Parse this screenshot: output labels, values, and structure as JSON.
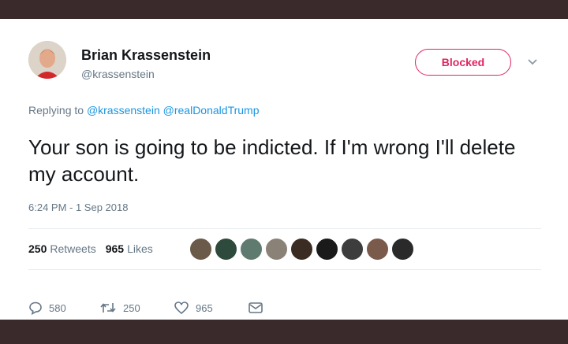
{
  "tweet": {
    "author_name": "Brian Krassenstein",
    "author_handle": "@krassenstein",
    "blocked_label": "Blocked",
    "replying_prefix": "Replying to",
    "reply_mentions": [
      "@krassenstein",
      "@realDonaldTrump"
    ],
    "text": "Your son is going to be indicted. If I'm wrong I'll delete my account.",
    "timestamp": "6:24 PM - 1 Sep 2018"
  },
  "stats": {
    "retweets_count": "250",
    "retweets_label": "Retweets",
    "likes_count": "965",
    "likes_label": "Likes"
  },
  "likers": [
    {
      "icon": "liker-avatar",
      "color": "#6b5a4a"
    },
    {
      "icon": "liker-avatar",
      "color": "#2e4a3c"
    },
    {
      "icon": "liker-avatar",
      "color": "#5f7a6e"
    },
    {
      "icon": "liker-avatar",
      "color": "#8a8276"
    },
    {
      "icon": "liker-avatar",
      "color": "#3a2c22"
    },
    {
      "icon": "liker-avatar",
      "color": "#1a1a1a"
    },
    {
      "icon": "liker-avatar",
      "color": "#3d3d3d"
    },
    {
      "icon": "liker-avatar",
      "color": "#7a5a4a"
    },
    {
      "icon": "liker-avatar",
      "color": "#2a2a2a"
    }
  ],
  "actions": {
    "reply_count": "580",
    "retweet_count": "250",
    "like_count": "965"
  },
  "colors": {
    "blocked": "#e0245e",
    "link": "#1b95e0",
    "muted": "#657786",
    "text": "#14171a"
  }
}
